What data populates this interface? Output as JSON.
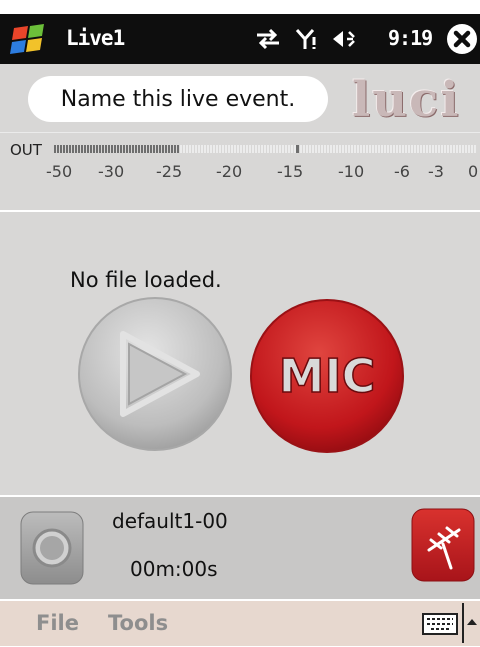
{
  "titlebar": {
    "app_title": "Live1",
    "time": "9:19"
  },
  "event": {
    "name_placeholder": "Name this live event."
  },
  "logo": {
    "text": "luci"
  },
  "meter": {
    "label": "OUT",
    "ticks": [
      "-50",
      "-30",
      "-25",
      "-20",
      "-15",
      "-10",
      "-6",
      "-3",
      "0"
    ],
    "level_fraction": 0.3
  },
  "player": {
    "status": "No file loaded.",
    "mic_label": "MIC"
  },
  "bottom": {
    "file_name": "default1-00",
    "timer": "00m:00s"
  },
  "menu": {
    "file": "File",
    "tools": "Tools"
  },
  "colors": {
    "titlebar": "#0e0e0e",
    "panel": "#d8d7d6",
    "mic": "#c1161b",
    "menubar": "#e7d8cf"
  }
}
